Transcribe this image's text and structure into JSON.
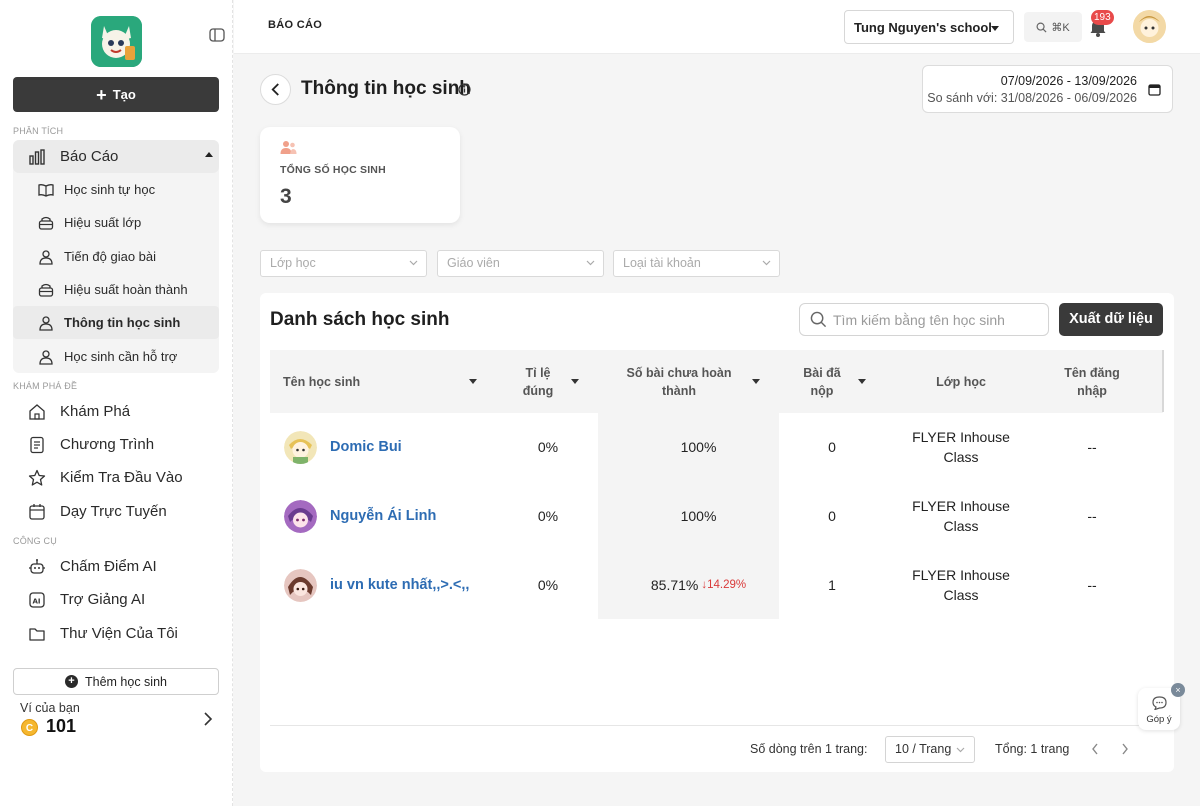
{
  "sidebar": {
    "create_label": "Tạo",
    "sections": {
      "analysis": "PHÂN TÍCH",
      "explore": "KHÁM PHÁ ĐỀ",
      "tools": "CÔNG CỤ"
    },
    "report_group": {
      "label": "Báo Cáo",
      "items": [
        {
          "label": "Học sinh tự học",
          "icon": "book-open-icon"
        },
        {
          "label": "Hiệu suất lớp",
          "icon": "classroom-icon"
        },
        {
          "label": "Tiến độ giao bài",
          "icon": "users-icon"
        },
        {
          "label": "Hiệu suất hoàn thành",
          "icon": "classroom-icon"
        },
        {
          "label": "Thông tin học sinh",
          "icon": "users-icon"
        },
        {
          "label": "Học sinh cần hỗ trợ",
          "icon": "users-icon"
        }
      ]
    },
    "explore_items": [
      {
        "label": "Khám Phá",
        "icon": "home-icon"
      },
      {
        "label": "Chương Trình",
        "icon": "document-icon"
      },
      {
        "label": "Kiểm Tra Đầu Vào",
        "icon": "star-icon"
      },
      {
        "label": "Dạy Trực Tuyến",
        "icon": "calendar-icon"
      }
    ],
    "tool_items": [
      {
        "label": "Chấm Điểm AI",
        "icon": "robot-icon"
      },
      {
        "label": "Trợ Giảng AI",
        "icon": "ai-icon"
      },
      {
        "label": "Thư Viện Của Tôi",
        "icon": "folder-icon"
      }
    ],
    "add_student_label": "Thêm học sinh",
    "wallet_label": "Ví của bạn",
    "wallet_coin": "C",
    "wallet_value": "101"
  },
  "header": {
    "title": "BÁO CÁO",
    "school": "Tung Nguyen's school",
    "shortcut": "⌘K",
    "notification_count": "193"
  },
  "main": {
    "page_title": "Thông tin học sinh",
    "date_range": "07/09/2026 - 13/09/2026",
    "compare_range": "So sánh với: 31/08/2026 - 06/09/2026",
    "stat": {
      "label": "TỔNG SỐ HỌC SINH",
      "value": "3"
    },
    "filters": [
      {
        "placeholder": "Lớp học"
      },
      {
        "placeholder": "Giáo viên"
      },
      {
        "placeholder": "Loại tài khoản"
      }
    ],
    "table": {
      "title": "Danh sách học sinh",
      "search_placeholder": "Tìm kiếm bằng tên học sinh",
      "export_label": "Xuất dữ liệu",
      "columns": [
        "Tên học sinh",
        "Tỉ lệ đúng",
        "Số bài chưa hoàn thành",
        "Bài đã nộp",
        "Lớp học",
        "Tên đăng nhập"
      ],
      "rows": [
        {
          "name": "Domic Bui",
          "accuracy": "0%",
          "incomplete": "100%",
          "incomplete_change": "",
          "submitted": "0",
          "class": "FLYER Inhouse Class",
          "username": "--"
        },
        {
          "name": "Nguyễn Ái Linh",
          "accuracy": "0%",
          "incomplete": "100%",
          "incomplete_change": "",
          "submitted": "0",
          "class": "FLYER Inhouse Class",
          "username": "--"
        },
        {
          "name": "iu vn kute nhất,,>.<,,",
          "accuracy": "0%",
          "incomplete": "85.71%",
          "incomplete_change": "↓14.29%",
          "submitted": "1",
          "class": "FLYER Inhouse Class",
          "username": "--"
        }
      ]
    },
    "pagination": {
      "rows_label": "Số dòng trên 1 trang:",
      "per_page": "10 / Trang",
      "total": "Tổng: 1 trang"
    }
  },
  "feedback": {
    "label": "Góp ý",
    "close": "×"
  },
  "colors": {
    "accent_dark": "#3a3a3a",
    "link": "#2d6cb3",
    "down": "#d93a3a",
    "badge": "#e84a4a"
  }
}
